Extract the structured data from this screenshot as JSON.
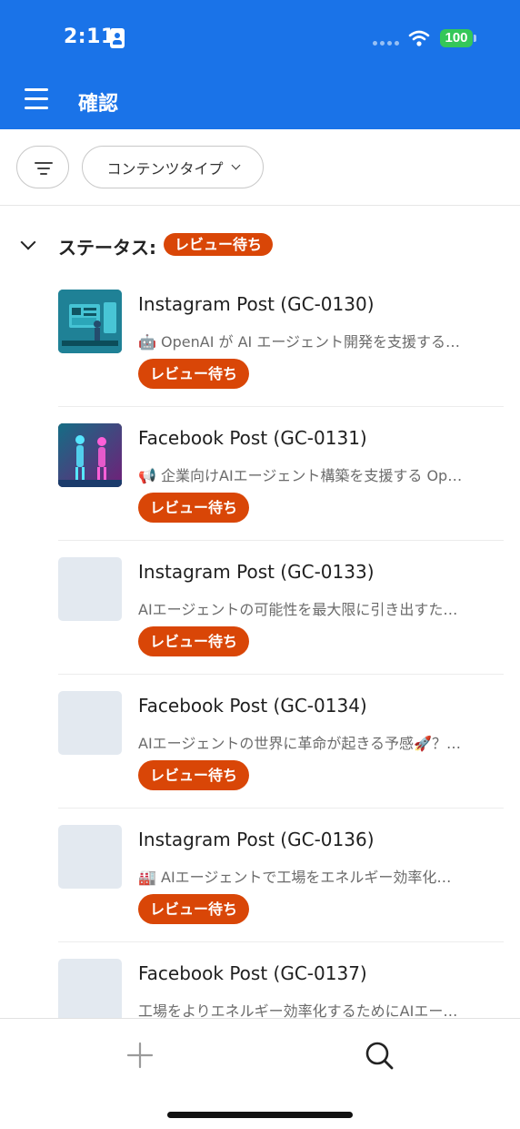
{
  "status_bar": {
    "time": "2:11",
    "battery": "100"
  },
  "header": {
    "title": "確認"
  },
  "filters": {
    "content_type_label": "コンテンツタイプ"
  },
  "group": {
    "label": "ステータス:",
    "badge": "レビュー待ち"
  },
  "items": [
    {
      "title": "Instagram Post (GC-0130)",
      "preview": "🤖 OpenAI が AI エージェント開発を支援する…",
      "badge": "レビュー待ち",
      "thumb": "robot-dashboard"
    },
    {
      "title": "Facebook Post (GC-0131)",
      "preview": "📢 企業向けAIエージェント構築を支援する Op…",
      "badge": "レビュー待ち",
      "thumb": "hologram-figures"
    },
    {
      "title": "Instagram Post (GC-0133)",
      "preview": "AIエージェントの可能性を最大限に引き出すた…",
      "badge": "レビュー待ち",
      "thumb": "placeholder"
    },
    {
      "title": "Facebook Post (GC-0134)",
      "preview": "AIエージェントの世界に革命が起きる予感🚀？…",
      "badge": "レビュー待ち",
      "thumb": "placeholder"
    },
    {
      "title": "Instagram Post (GC-0136)",
      "preview": "🏭 AIエージェントで工場をエネルギー効率化…",
      "badge": "レビュー待ち",
      "thumb": "placeholder"
    },
    {
      "title": "Facebook Post (GC-0137)",
      "preview": "工場をよりエネルギー効率化するためにAIエー…",
      "badge": "",
      "thumb": "placeholder"
    }
  ],
  "colors": {
    "header_bg": "#1a73e8",
    "badge_bg": "#d94607",
    "battery": "#34c759",
    "thumb_placeholder": "#e3e9f0"
  },
  "icons": {
    "menu": "hamburger-icon",
    "filter": "filter-lines-icon",
    "add": "plus-icon",
    "search": "magnifier-icon"
  }
}
